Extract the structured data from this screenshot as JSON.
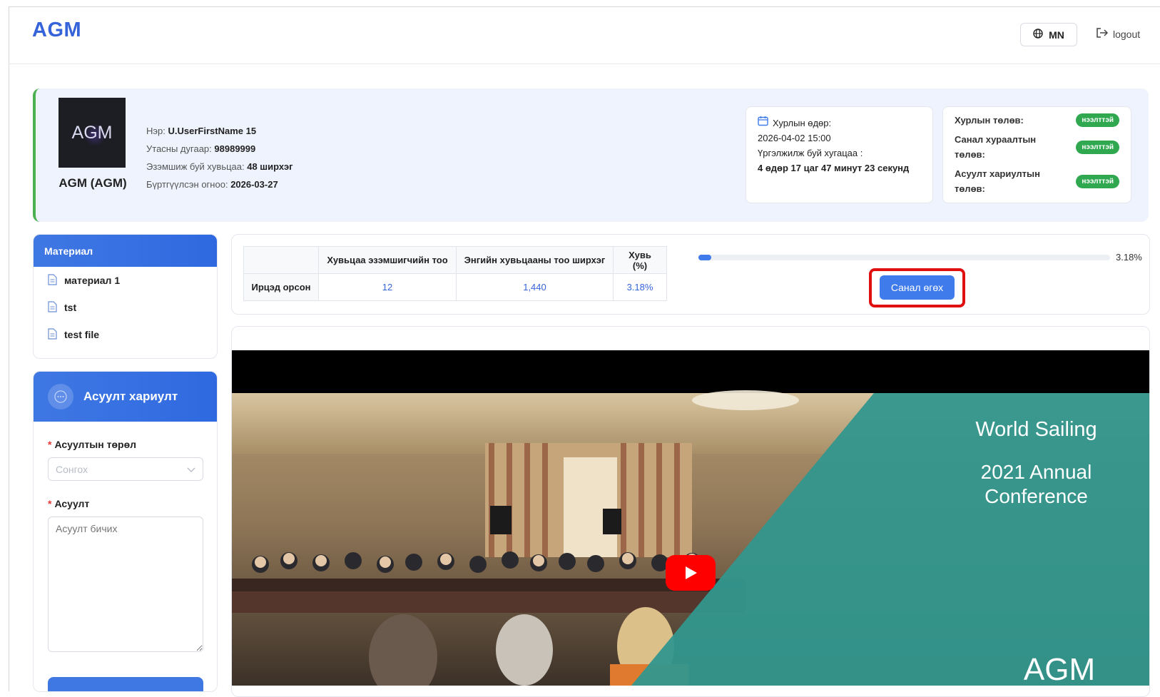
{
  "header": {
    "logo": "AGM",
    "language": "MN",
    "logout_label": "logout"
  },
  "profile": {
    "avatar_text": "AGM",
    "company_name": "AGM (AGM)",
    "name_label": "Нэр:",
    "name_value": "U.UserFirstName 15",
    "phone_label": "Утасны дугаар:",
    "phone_value": "98989999",
    "shares_label": "Эзэмшиж буй хувьцаа:",
    "shares_value": "48 ширхэг",
    "registered_label": "Бүртгүүлсэн огноо:",
    "registered_value": "2026-03-27"
  },
  "meeting": {
    "date_label": "Хурлын өдөр:",
    "date_value": "2026-04-02 15:00",
    "remaining_label": "Үргэлжилж буй хугацаа :",
    "remaining_value": "4 өдөр 17 цаг 47 минут 23 секунд"
  },
  "payments": [
    {
      "label": "Хурлын төлөв:",
      "status": "нээлттэй"
    },
    {
      "label": "Санал хураалтын төлөв:",
      "status": "нээлттэй"
    },
    {
      "label": "Асуулт хариултын төлөв:",
      "status": "нээлттэй"
    }
  ],
  "materials": {
    "title": "Материал",
    "items": [
      "материал 1",
      "tst",
      "test file"
    ]
  },
  "qa": {
    "title": "Асуулт хариулт",
    "type_label": "Асуултын төрөл",
    "type_placeholder": "Сонгох",
    "question_label": "Асуулт",
    "question_placeholder": "Асуулт бичих",
    "required_mark": "*"
  },
  "stats": {
    "headers": [
      "",
      "Хувьцаа эзэмшигчийн тоо",
      "Энгийн хувьцааны тоо ширхэг",
      "Хувь (%)"
    ],
    "row_label": "Ирцэд орсон",
    "holders": "12",
    "shares": "1,440",
    "percent": "3.18%",
    "progress_fraction": 0.0318,
    "progress_label": "3.18%",
    "vote_button": "Санал өгөх"
  },
  "video": {
    "title_line": "World Sailing",
    "subtitle": "2021 Annual Conference",
    "brand": "AGM"
  },
  "colors": {
    "primary": "#3f7bea",
    "success": "#2fa84f",
    "highlight": "#e01010"
  }
}
